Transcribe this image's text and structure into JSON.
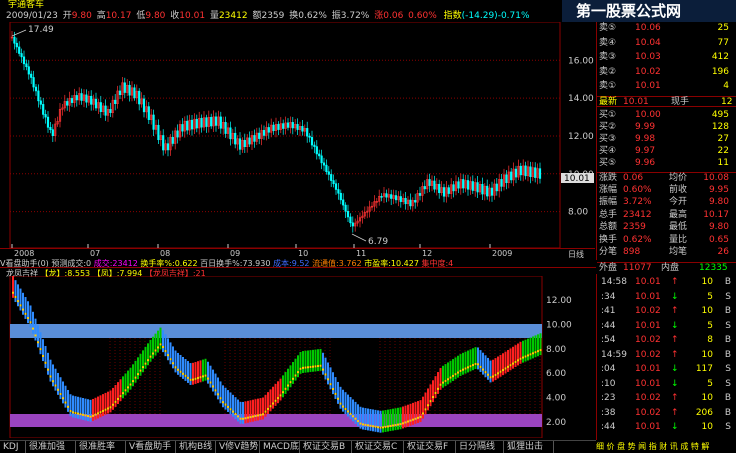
{
  "header": {
    "stock_name": "宇通客车",
    "date": "2009/01/23",
    "open_label": "开",
    "open": "9.80",
    "high_label": "高",
    "high": "10.17",
    "low_label": "低",
    "low": "9.80",
    "close_label": "收",
    "close": "10.01",
    "vol_label": "量",
    "vol": "23412",
    "amt_label": "额",
    "amt": "2359",
    "turn_label": "换",
    "turn": "0.62%",
    "amp_label": "振",
    "amp": "3.72%",
    "chg_label": "涨",
    "chg": "0.06",
    "chg_pct": "0.60%",
    "index_label": "指数",
    "index_val": "(-14.29)-0.71%"
  },
  "logo": {
    "title": "第一股票公式网",
    "url": "www.chnmoney.com"
  },
  "main_chart": {
    "high_marker": "17.49",
    "low_marker": "6.79",
    "last_price_tag": "10.01",
    "y_ticks": [
      "16.00",
      "14.00",
      "12.00",
      "10.00",
      "8.00"
    ],
    "x_ticks": [
      "2008",
      "07",
      "08",
      "09",
      "10",
      "11",
      "12",
      "2009"
    ],
    "period_label": "日线"
  },
  "indicator_bar1": {
    "name": "V看盘助手(0)",
    "predict": "预测成交:0",
    "fill": "成交:23412",
    "turnover": "换手率%:0.622",
    "hundred": "百日换手%:73.930",
    "cost": "成本:9.52",
    "float_cap": "流通值:3.762",
    "pe": "市盈率:10.427",
    "conc": "集中度:4"
  },
  "indicator_bar2": {
    "name": "龙凤吉祥",
    "dragon": "【龙】:8.553",
    "phoenix": "【凤】:7.994",
    "lucky": "【龙凤吉祥】:21"
  },
  "ind_chart": {
    "y_ticks": [
      "12.00",
      "10.00",
      "8.00",
      "6.00",
      "4.00",
      "2.00"
    ]
  },
  "quote": {
    "asks": [
      {
        "label": "卖⑤",
        "price": "10.06",
        "vol": "25"
      },
      {
        "label": "卖④",
        "price": "10.04",
        "vol": "77"
      },
      {
        "label": "卖③",
        "price": "10.03",
        "vol": "412"
      },
      {
        "label": "卖②",
        "price": "10.02",
        "vol": "196"
      },
      {
        "label": "卖①",
        "price": "10.01",
        "vol": "4"
      }
    ],
    "latest_label": "最新",
    "latest": "10.01",
    "cur_label": "现手",
    "cur": "12",
    "bids": [
      {
        "label": "买①",
        "price": "10.00",
        "vol": "495"
      },
      {
        "label": "买②",
        "price": "9.99",
        "vol": "128"
      },
      {
        "label": "买③",
        "price": "9.98",
        "vol": "27"
      },
      {
        "label": "买④",
        "price": "9.97",
        "vol": "22"
      },
      {
        "label": "买⑤",
        "price": "9.96",
        "vol": "11"
      }
    ],
    "stats": [
      {
        "l1": "涨跌",
        "v1": "0.06",
        "l2": "均价",
        "v2": "10.08"
      },
      {
        "l1": "涨幅",
        "v1": "0.60%",
        "l2": "前收",
        "v2": "9.95"
      },
      {
        "l1": "振幅",
        "v1": "3.72%",
        "l2": "今开",
        "v2": "9.80"
      },
      {
        "l1": "总手",
        "v1": "23412",
        "l2": "最高",
        "v2": "10.17"
      },
      {
        "l1": "总额",
        "v1": "2359",
        "l2": "最低",
        "v2": "9.80"
      },
      {
        "l1": "换手",
        "v1": "0.62%",
        "l2": "量比",
        "v2": "0.65"
      },
      {
        "l1": "分笔",
        "v1": "898",
        "l2": "均笔",
        "v2": "26"
      }
    ],
    "outer_label": "外盘",
    "outer": "11077",
    "inner_label": "内盘",
    "inner": "12335"
  },
  "ticks": [
    {
      "time": "14:58",
      "price": "10.01",
      "arrow": "↑",
      "vol": "10",
      "side": "B"
    },
    {
      "time": ":34",
      "price": "10.01",
      "arrow": "↓",
      "vol": "5",
      "side": "S"
    },
    {
      "time": ":41",
      "price": "10.02",
      "arrow": "↑",
      "vol": "10",
      "side": "B"
    },
    {
      "time": ":44",
      "price": "10.01",
      "arrow": "↓",
      "vol": "5",
      "side": "S"
    },
    {
      "time": ":54",
      "price": "10.02",
      "arrow": "↑",
      "vol": "8",
      "side": "B"
    },
    {
      "time": "14:59",
      "price": "10.02",
      "arrow": "↑",
      "vol": "10",
      "side": "B"
    },
    {
      "time": ":04",
      "price": "10.01",
      "arrow": "↓",
      "vol": "117",
      "side": "S"
    },
    {
      "time": ":10",
      "price": "10.01",
      "arrow": "↓",
      "vol": "5",
      "side": "S"
    },
    {
      "time": ":23",
      "price": "10.02",
      "arrow": "↑",
      "vol": "10",
      "side": "B"
    },
    {
      "time": ":38",
      "price": "10.02",
      "arrow": "↑",
      "vol": "206",
      "side": "B"
    },
    {
      "time": ":44",
      "price": "10.01",
      "arrow": "↓",
      "vol": "10",
      "side": "S"
    }
  ],
  "right_tabs": "细 价 盘 势 闻 指 财 讯 成 特 解",
  "tabs": [
    "KDJ",
    "很准加强",
    "很准胜率",
    "V看盘助手",
    "机构B线",
    "V修V趋势",
    "MACD底",
    "权证交易B",
    "权证交易C",
    "权证交易F",
    "日分隔线",
    "狐狸出击"
  ],
  "colors": {
    "up": "#ff3232",
    "down": "#00ffff",
    "yellow": "#ffff00",
    "grid": "#8a0000"
  }
}
